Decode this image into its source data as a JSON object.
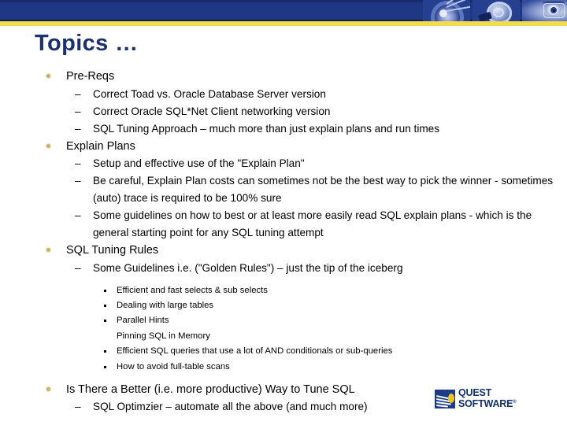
{
  "slide": {
    "title": "Topics …",
    "colors": {
      "band_blue": "#1f3885",
      "band_yellow": "#f2dc4e",
      "title_blue": "#1b2f73",
      "bullet_gold": "#c9b35a",
      "logo_blue": "#13306e",
      "logo_gold": "#f0c419"
    }
  },
  "header": {
    "photos": [
      {
        "name": "disc-photo",
        "alt": "compact disc"
      },
      {
        "name": "lightbulb-photo",
        "alt": "light bulb"
      },
      {
        "name": "eye-photo",
        "alt": "eye with glasses"
      }
    ]
  },
  "content": {
    "items": [
      {
        "level": 1,
        "text": "Pre-Reqs"
      },
      {
        "level": 2,
        "text": "Correct Toad vs. Oracle Database Server version"
      },
      {
        "level": 2,
        "text": "Correct Oracle SQL*Net Client networking version"
      },
      {
        "level": 2,
        "text": "SQL Tuning Approach – much more than just explain plans and run times"
      },
      {
        "level": 1,
        "text": "Explain Plans"
      },
      {
        "level": 2,
        "text": "Setup and effective use of the \"Explain Plan\""
      },
      {
        "level": 2,
        "text": "Be careful, Explain Plan costs can sometimes not be the best way to pick the winner - sometimes (auto) trace is required to be 100% sure"
      },
      {
        "level": 2,
        "text": "Some guidelines on how to best or at least more easily read SQL explain plans - which is the general starting point for any SQL tuning attempt"
      },
      {
        "level": 1,
        "text": "SQL Tuning Rules"
      },
      {
        "level": 2,
        "text": "Some Guidelines i.e. (\"Golden Rules\") – just the tip of the iceberg"
      },
      {
        "level": 3,
        "text": "Efficient and fast selects & sub selects"
      },
      {
        "level": 3,
        "text": "Dealing with large tables"
      },
      {
        "level": 3,
        "text": "Parallel Hints",
        "extra_line": "Pinning SQL in Memory"
      },
      {
        "level": 3,
        "text": "Efficient SQL queries that use a lot of AND conditionals or sub-queries"
      },
      {
        "level": 3,
        "text": "How to avoid full-table scans"
      },
      {
        "level": 1,
        "text": "Is There a Better (i.e. more productive) Way to Tune SQL"
      },
      {
        "level": 2,
        "text": "SQL Optimzier – automate all the above (and much more)"
      }
    ],
    "dash_marker": "–"
  },
  "logo": {
    "line1": "QUEST",
    "line2": "SOFTWARE",
    "registered": "®"
  }
}
